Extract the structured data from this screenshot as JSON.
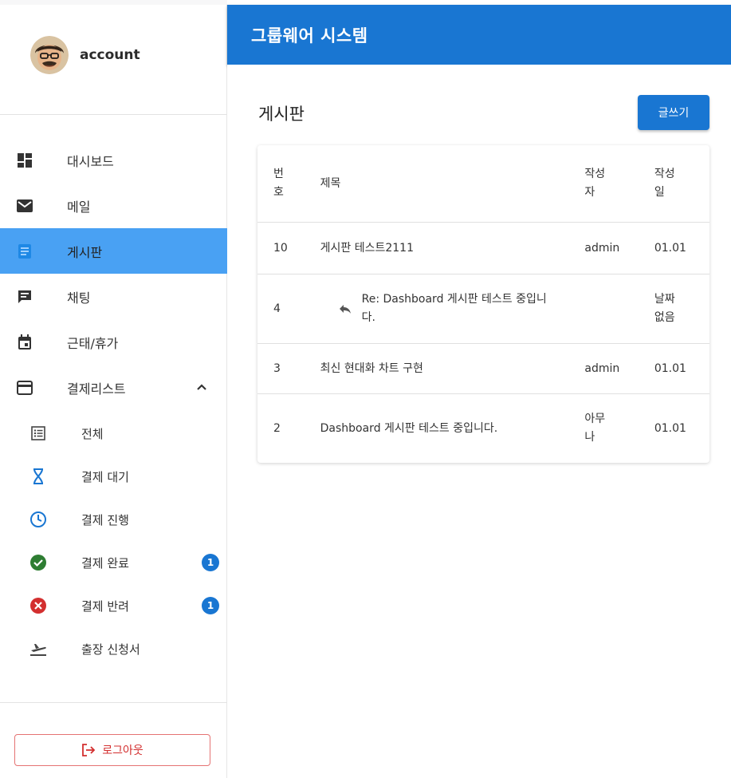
{
  "app": {
    "title": "그룹웨어 시스템"
  },
  "account": {
    "name": "account"
  },
  "nav": {
    "items": [
      {
        "label": "대시보드",
        "icon": "dashboard-icon"
      },
      {
        "label": "메일",
        "icon": "mail-icon"
      },
      {
        "label": "게시판",
        "icon": "board-icon",
        "active": true
      },
      {
        "label": "채팅",
        "icon": "chat-icon"
      },
      {
        "label": "근태/휴가",
        "icon": "calendar-icon"
      },
      {
        "label": "결제리스트",
        "icon": "payment-card-icon",
        "expanded": true
      }
    ],
    "sub_items": [
      {
        "label": "전체",
        "icon": "list-icon"
      },
      {
        "label": "결제 대기",
        "icon": "hourglass-icon"
      },
      {
        "label": "결제 진행",
        "icon": "clock-icon"
      },
      {
        "label": "결제 완료",
        "icon": "check-circle-icon",
        "badge": "1"
      },
      {
        "label": "결제 반려",
        "icon": "cancel-circle-icon",
        "badge": "1"
      },
      {
        "label": "출장 신청서",
        "icon": "flight-takeoff-icon"
      }
    ]
  },
  "logout": {
    "label": "로그아웃"
  },
  "board": {
    "title": "게시판",
    "write_label": "글쓰기",
    "columns": {
      "num": "번호",
      "title": "제목",
      "author": "작성자",
      "date": "작성일"
    },
    "rows": [
      {
        "num": "10",
        "title": "게시판 테스트2111",
        "author": "admin",
        "date": "01.01"
      },
      {
        "num": "4",
        "title": "Re: Dashboard 게시판 테스트 중입니다.",
        "author": "",
        "date": "날짜 없음",
        "reply": true
      },
      {
        "num": "3",
        "title": "최신 현대화 차트 구현",
        "author": "admin",
        "date": "01.01"
      },
      {
        "num": "2",
        "title": "Dashboard 게시판 테스트 중입니다.",
        "author": "아무나",
        "date": "01.01"
      }
    ]
  },
  "colors": {
    "primary": "#1976d2",
    "active_nav": "#49a1f3",
    "success": "#2e7d32",
    "error": "#d32f2f",
    "info": "#1976d2"
  }
}
